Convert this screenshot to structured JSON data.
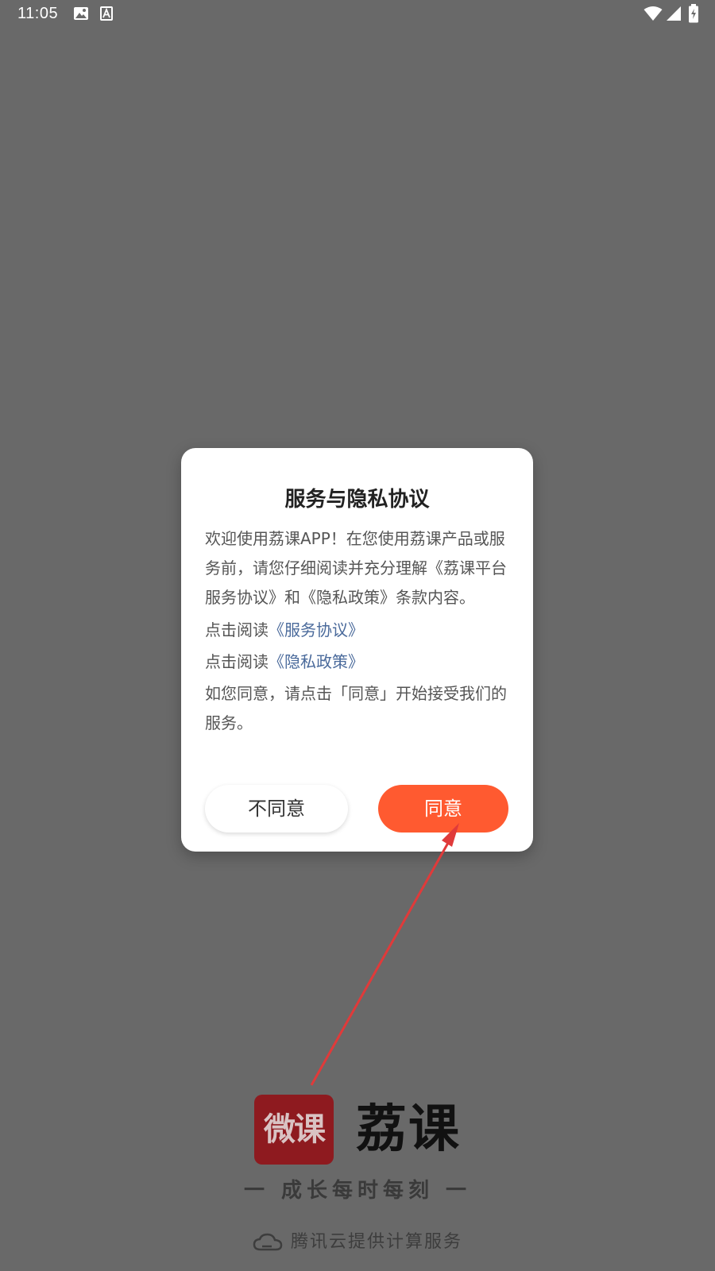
{
  "status_bar": {
    "time": "11:05",
    "icons_left": [
      "image-icon",
      "font-icon"
    ],
    "icons_right": [
      "wifi-icon",
      "signal-icon",
      "battery-icon"
    ]
  },
  "dialog": {
    "title": "服务与隐私协议",
    "intro": "欢迎使用荔课APP！在您使用荔课产品或服务前，请您仔细阅读并充分理解《荔课平台服务协议》和《隐私政策》条款内容。",
    "service_prefix": "点击阅读",
    "service_link": "《服务协议》",
    "privacy_prefix": "点击阅读",
    "privacy_link": "《隐私政策》",
    "consent_text": "如您同意，请点击「同意」开始接受我们的服务。",
    "disagree_label": "不同意",
    "agree_label": "同意"
  },
  "splash": {
    "logo_text": "微课",
    "brand_name": "荔课",
    "slogan": "一 成长每时每刻 一",
    "powered_by": "腾讯云提供计算服务"
  },
  "colors": {
    "background": "#696969",
    "accent": "#ff5a30",
    "link": "#4a6a9b",
    "logo": "#8e1a1f",
    "annotation": "#e03a3a"
  }
}
